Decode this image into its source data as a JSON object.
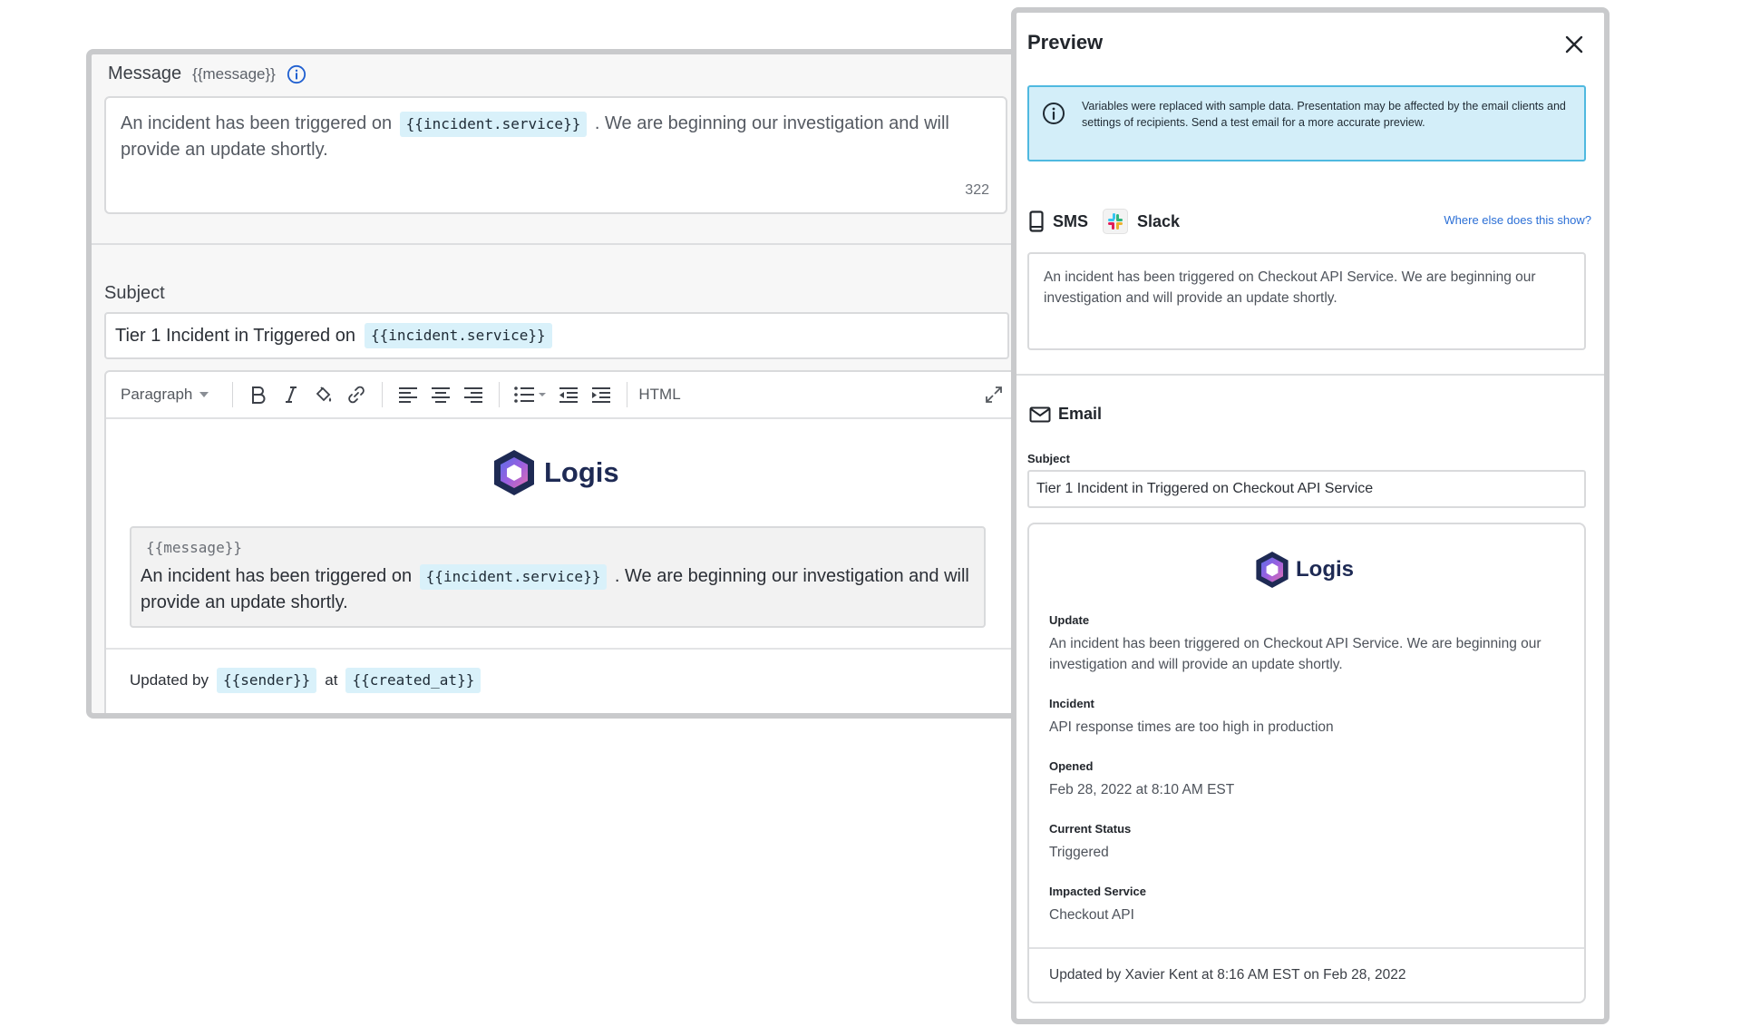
{
  "editor": {
    "message_label": "Message",
    "message_var": "{{message}}",
    "message_text_before": "An incident has been triggered on",
    "message_chip": "{{incident.service}}",
    "message_text_after": ". We are beginning our investigation and will provide an update shortly.",
    "char_count": "322",
    "subject_label": "Subject",
    "subject_text": "Tier 1 Incident in Triggered on",
    "subject_chip": "{{incident.service}}",
    "toolbar": {
      "paragraph": "Paragraph",
      "html": "HTML"
    },
    "logo_text": "Logis",
    "block_var": "{{message}}",
    "block_text_before": "An incident has been triggered on",
    "block_chip": "{{incident.service}}",
    "block_text_after": ". We are beginning our investigation and will provide an update shortly.",
    "updated_by": "Updated by",
    "sender_chip": "{{sender}}",
    "at_text": "at",
    "created_chip": "{{created_at}}"
  },
  "preview": {
    "title": "Preview",
    "notice": "Variables were replaced with sample data. Presentation may be affected by the email clients and settings of recipients. Send a test email for a more accurate preview.",
    "sms_label": "SMS",
    "slack_label": "Slack",
    "where_link": "Where else does this show?",
    "sms_text": "An incident has been triggered on Checkout API Service. We are beginning our investigation and will provide an update shortly.",
    "email_label": "Email",
    "subject_label": "Subject",
    "subject_value": "Tier 1 Incident in Triggered on Checkout API Service",
    "logo_text": "Logis",
    "update_label": "Update",
    "update_value": "An incident has been triggered on Checkout API Service. We are beginning our investigation and will provide an update shortly.",
    "incident_label": "Incident",
    "incident_value": "API response times are too high in production",
    "opened_label": "Opened",
    "opened_value": "Feb 28, 2022 at 8:10 AM EST",
    "status_label": "Current Status",
    "status_value": "Triggered",
    "service_label": "Impacted Service",
    "service_value": "Checkout API",
    "footer": "Updated by Xavier Kent at 8:16 AM EST on Feb 28, 2022"
  },
  "colors": {
    "chip_bg": "#d9f1fa",
    "notice_bg": "#d3eef9",
    "notice_border": "#4fb9e0",
    "link": "#2b6fd6",
    "info_blue": "#1f5fd0",
    "logo_navy": "#1e2a54"
  },
  "icons": [
    "info-icon",
    "bold-icon",
    "italic-icon",
    "paint-bucket-icon",
    "link-icon",
    "align-left-icon",
    "align-center-icon",
    "align-right-icon",
    "bullet-list-icon",
    "outdent-icon",
    "indent-icon",
    "expand-icon",
    "close-icon",
    "phone-icon",
    "slack-icon",
    "mail-icon",
    "logis-logo-icon"
  ]
}
